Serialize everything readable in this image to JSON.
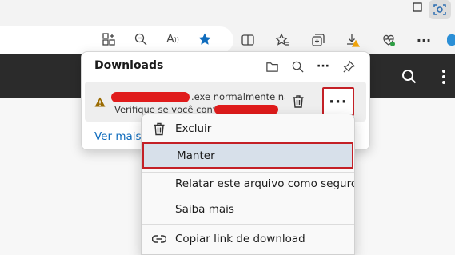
{
  "downloads_panel": {
    "title": "Downloads",
    "item": {
      "line1_suffix": ".exe normalmente não",
      "line2_prefix": "Verifique se você confia"
    },
    "see_more": "Ver mais"
  },
  "context_menu": {
    "items": [
      {
        "label": "Excluir",
        "icon": "trash-icon"
      },
      {
        "label": "Manter",
        "icon": ""
      },
      {
        "label": "Relatar este arquivo como seguro",
        "icon": ""
      },
      {
        "label": "Saiba mais",
        "icon": ""
      },
      {
        "label": "Copiar link de download",
        "icon": "link-icon"
      }
    ]
  },
  "colors": {
    "accent_blue": "#0f6cbd",
    "highlight_red": "#c42026",
    "warning": "#f0a30a",
    "dark_header": "#2b2b2b"
  }
}
